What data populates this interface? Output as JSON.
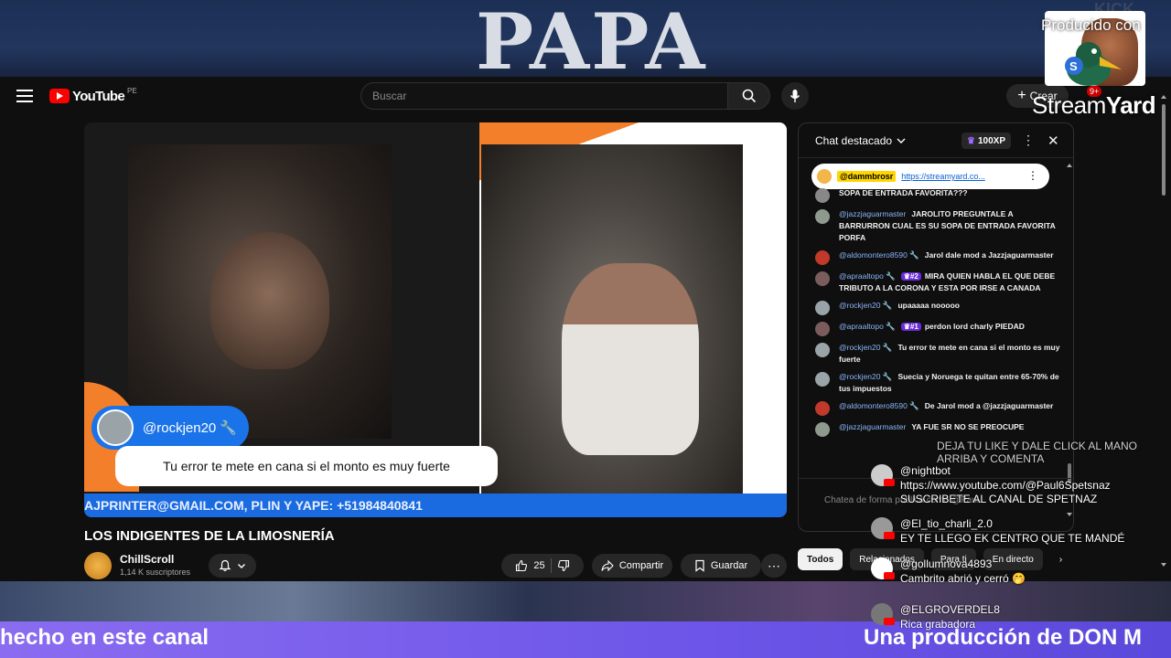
{
  "background": {
    "top_title": "PAPA",
    "top_right_text": "KICK",
    "produced_label": "Producido con",
    "streamyard_brand_bold": "Stream",
    "streamyard_brand_rest": "Yard",
    "bottom_left_text": "hecho en este canal",
    "bottom_right_text": "Una producción de DON M"
  },
  "youtube": {
    "logo_word": "YouTube",
    "logo_region": "PE",
    "search": {
      "placeholder": "Buscar"
    },
    "create_label": "Crear",
    "notification_count": "9+"
  },
  "video": {
    "overlay_user": "@rockjen20 🔧",
    "overlay_comment": "Tu error te mete en cana si el monto es muy fuerte",
    "ticker": "AJPRINTER@GMAIL.COM, PLIN Y YAPE: +51984840841"
  },
  "meta": {
    "title": "LOS INDIGENTES DE LA LIMOSNERÍA",
    "channel_name": "ChillScroll",
    "subscribers": "1,14 K suscriptores",
    "likes": "25",
    "share_label": "Compartir",
    "save_label": "Guardar"
  },
  "chat": {
    "title": "Chat destacado",
    "xp_label": "100XP",
    "pinned_user": "@dammbrosr",
    "pinned_link": "https://streamyard.co...",
    "input_placeholder": "Chatea de forma pública como @Paul...",
    "messages": [
      {
        "user": "",
        "badge": "",
        "text": "SOPA DE ENTRADA FAVORITA???",
        "color": "#888888"
      },
      {
        "user": "@jazzjaguarmaster",
        "badge": "",
        "text": "JAROLITO PREGUNTALE A BARRURRON CUAL ES SU SOPA DE ENTRADA FAVORITA PORFA",
        "color": "#8e9a8e"
      },
      {
        "user": "@aldomontero8590 🔧",
        "badge": "",
        "text": "Jarol dale mod a Jazzjaguarmaster",
        "color": "#c0392b"
      },
      {
        "user": "@apraaltopo 🔧",
        "badge": "♛#2",
        "text": "MIRA QUIEN HABLA EL QUE DEBE TRIBUTO A LA CORONA Y ESTA POR IRSE A CANADA",
        "color": "#7a5c5c"
      },
      {
        "user": "@rockjen20 🔧",
        "badge": "",
        "text": "upaaaaa nooooo",
        "color": "#9aa3a8"
      },
      {
        "user": "@apraaltopo 🔧",
        "badge": "♛#1",
        "text": "perdon lord charly PIEDAD",
        "color": "#7a5c5c"
      },
      {
        "user": "@rockjen20 🔧",
        "badge": "",
        "text": "Tu error te mete en cana si el monto es muy fuerte",
        "color": "#9aa3a8"
      },
      {
        "user": "@rockjen20 🔧",
        "badge": "",
        "text": "Suecia y Noruega te quitan entre 65-70% de tus impuestos",
        "color": "#9aa3a8"
      },
      {
        "user": "@aldomontero8590 🔧",
        "badge": "",
        "text": "De Jarol mod a @jazzjaguarmaster",
        "color": "#c0392b"
      },
      {
        "user": "@jazzjaguarmaster",
        "badge": "",
        "text": "YA FUE SR NO SE PREOCUPE",
        "color": "#8e9a8e"
      }
    ]
  },
  "filters": [
    "Todos",
    "Relacionados",
    "Para ti",
    "En directo"
  ],
  "overlay": {
    "hint": "DEJA TU LIKE Y DALE CLICK AL MANO ARRIBA Y COMENTA",
    "comments": [
      {
        "user": "@nightbot",
        "text": "https://www.youtube.com/@Paul6Spetsnaz\nSUSCRIBETE AL CANAL DE SPETNAZ",
        "color": "#cccccc"
      },
      {
        "user": "@El_tio_charli_2.0",
        "text": "EY TE LLEGO EK CENTRO QUE TE MANDÉ",
        "color": "#999999"
      },
      {
        "user": "@gollumnova4893",
        "text": "Cambrito abrió y cerró 🤭",
        "color": "#ffffff"
      },
      {
        "user": "@ELGROVERDEL8",
        "text": "Rica grabadora",
        "color": "#777777"
      }
    ]
  }
}
